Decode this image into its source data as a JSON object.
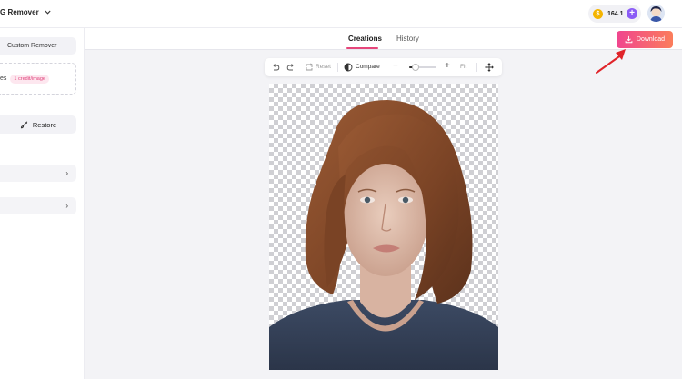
{
  "header": {
    "app_title": "G Remover",
    "credits": "164.1",
    "add_credit_symbol": "+"
  },
  "left_panel": {
    "custom_remover_label": "Custom Remover",
    "dashed_label": "es",
    "credit_badge": "1 credit/image",
    "restore_label": "Restore",
    "collapse_chevron": "›"
  },
  "tabs": [
    {
      "label": "Creations",
      "active": true
    },
    {
      "label": "History",
      "active": false
    }
  ],
  "download_label": "Download",
  "toolbar": {
    "reset_label": "Reset",
    "compare_label": "Compare",
    "zoom_out_symbol": "−",
    "zoom_in_symbol": "+",
    "fit_label": "Fit",
    "zoom_level": 0.2
  },
  "colors": {
    "accent": "#e6457a",
    "download_gradient_start": "#f0458f",
    "download_gradient_end": "#fb7d5b",
    "add_credit": "#8b5cf6",
    "coin": "#f4b400",
    "annotation_arrow": "#e0242a"
  },
  "icons": {
    "undo": "undo-icon",
    "redo": "redo-icon",
    "reset": "reset-icon",
    "compare": "compare-icon",
    "move": "move-icon",
    "download": "download-icon",
    "restore": "brush-icon",
    "coin": "coin-icon"
  }
}
